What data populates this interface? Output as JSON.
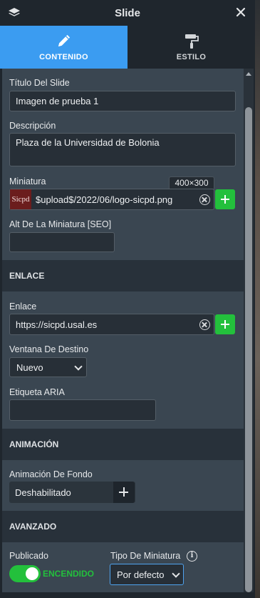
{
  "panel": {
    "title": "Slide"
  },
  "tabs": [
    {
      "label": "CONTENIDO",
      "icon": "pencil-icon",
      "active": true
    },
    {
      "label": "ESTILO",
      "icon": "paint-roller-icon",
      "active": false
    }
  ],
  "fields": {
    "slide_title": {
      "label": "Título Del Slide",
      "value": "Imagen de prueba 1"
    },
    "description": {
      "label": "Descripción",
      "value": "Plaza de la Universidad de Bolonia"
    },
    "thumbnail": {
      "label": "Miniatura",
      "value": "$upload$/2022/06/logo-sicpd.png",
      "dimensions": "400×300",
      "preview_text": "Sicpd"
    },
    "thumbnail_alt": {
      "label": "Alt De La Miniatura [SEO]",
      "value": ""
    }
  },
  "sections": {
    "link": "ENLACE",
    "animation": "ANIMACIÓN",
    "advanced": "AVANZADO"
  },
  "link": {
    "url": {
      "label": "Enlace",
      "value": "https://sicpd.usal.es"
    },
    "target": {
      "label": "Ventana De Destino",
      "value": "Nuevo"
    },
    "aria": {
      "label": "Etiqueta ARIA",
      "value": ""
    }
  },
  "animation": {
    "background": {
      "label": "Animación De Fondo",
      "value": "Deshabilitado"
    }
  },
  "advanced": {
    "published": {
      "label": "Publicado",
      "state": "ENCENDIDO",
      "on": true
    },
    "thumbnail_type": {
      "label": "Tipo De Miniatura",
      "value": "Por defecto"
    }
  },
  "colors": {
    "accent": "#3b9cf1",
    "success": "#23c03c",
    "panel_bg": "#1f262d",
    "content_bg": "#3a4651"
  }
}
